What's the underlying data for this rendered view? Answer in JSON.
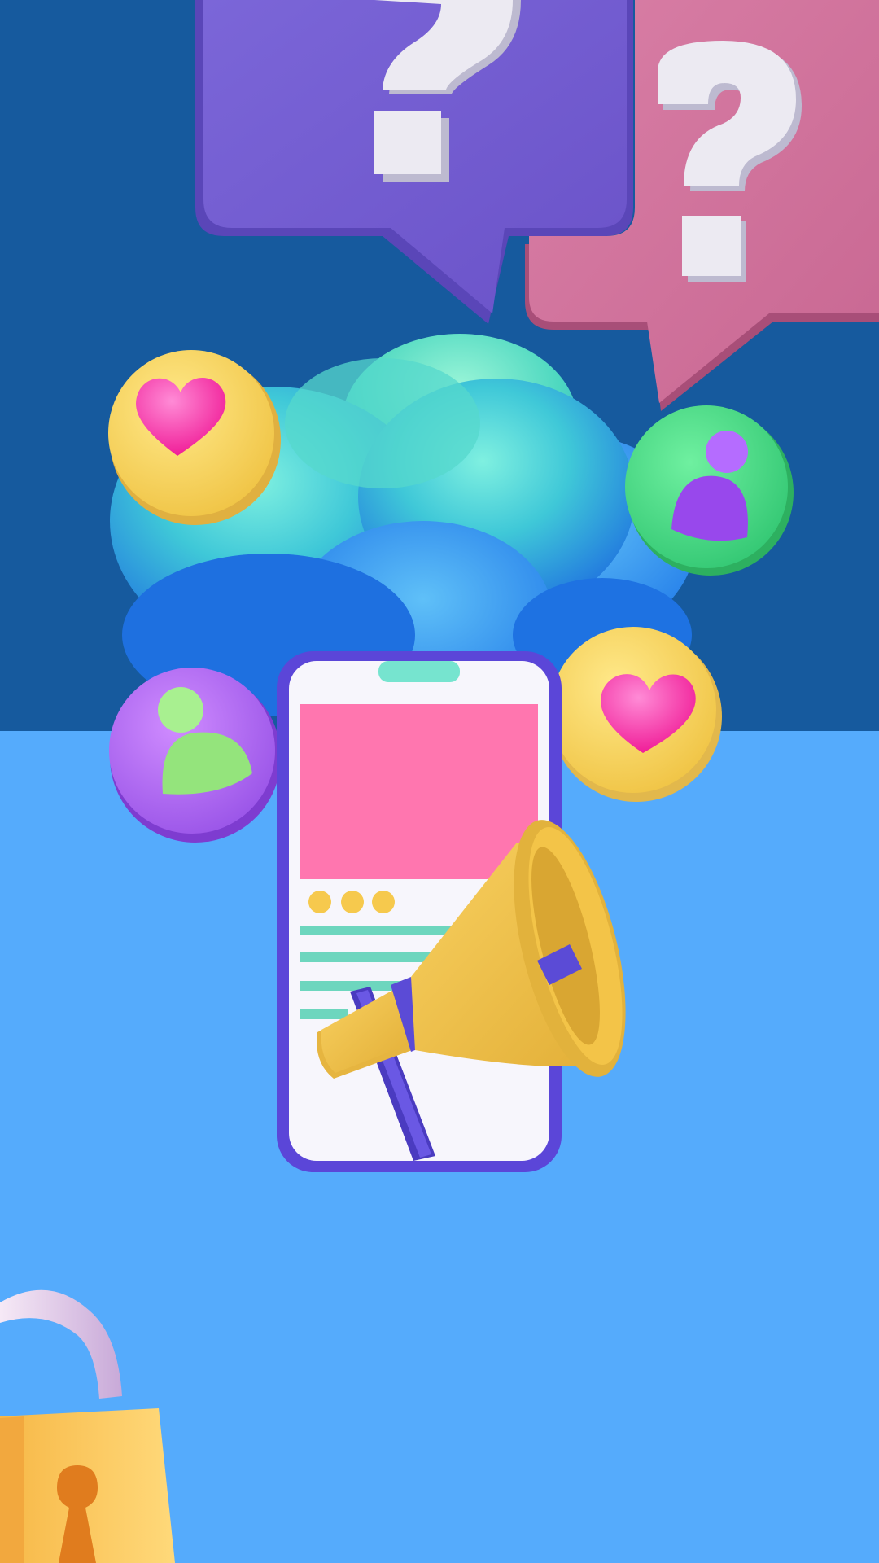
{
  "scene": {
    "colors": {
      "background_top": "#165A9E",
      "background_bottom": "#55ABFC",
      "bubble_purple": "#7460D0",
      "bubble_pink": "#D0749D",
      "question_mark": "#E8E6EE",
      "cloud_cyan": "#3FC8D8",
      "cloud_blue": "#2E8BEA",
      "cloud_green": "#5EE0B8",
      "badge_yellow": "#F5CF57",
      "badge_green": "#4FD98A",
      "badge_purple": "#B070F0",
      "heart_pink": "#FF3FB0",
      "user_purple": "#9A4BF0",
      "user_green": "#9BEA7A",
      "phone_frame": "#6A55E0",
      "phone_screen": "#F7F6FC",
      "phone_image": "#FF74AE",
      "phone_lines": "#6DD6BE",
      "phone_dots": "#F6C94D",
      "megaphone_yellow": "#F3C448",
      "megaphone_band": "#5B4BD6",
      "lock_body": "#F9C75A",
      "lock_shackle": "#E9D7F0",
      "keyhole": "#E07C1E"
    },
    "icons": [
      "question-mark-icon",
      "speech-bubble-icon",
      "cloud-icon",
      "heart-icon",
      "user-icon",
      "smartphone-icon",
      "megaphone-icon",
      "padlock-icon"
    ]
  }
}
